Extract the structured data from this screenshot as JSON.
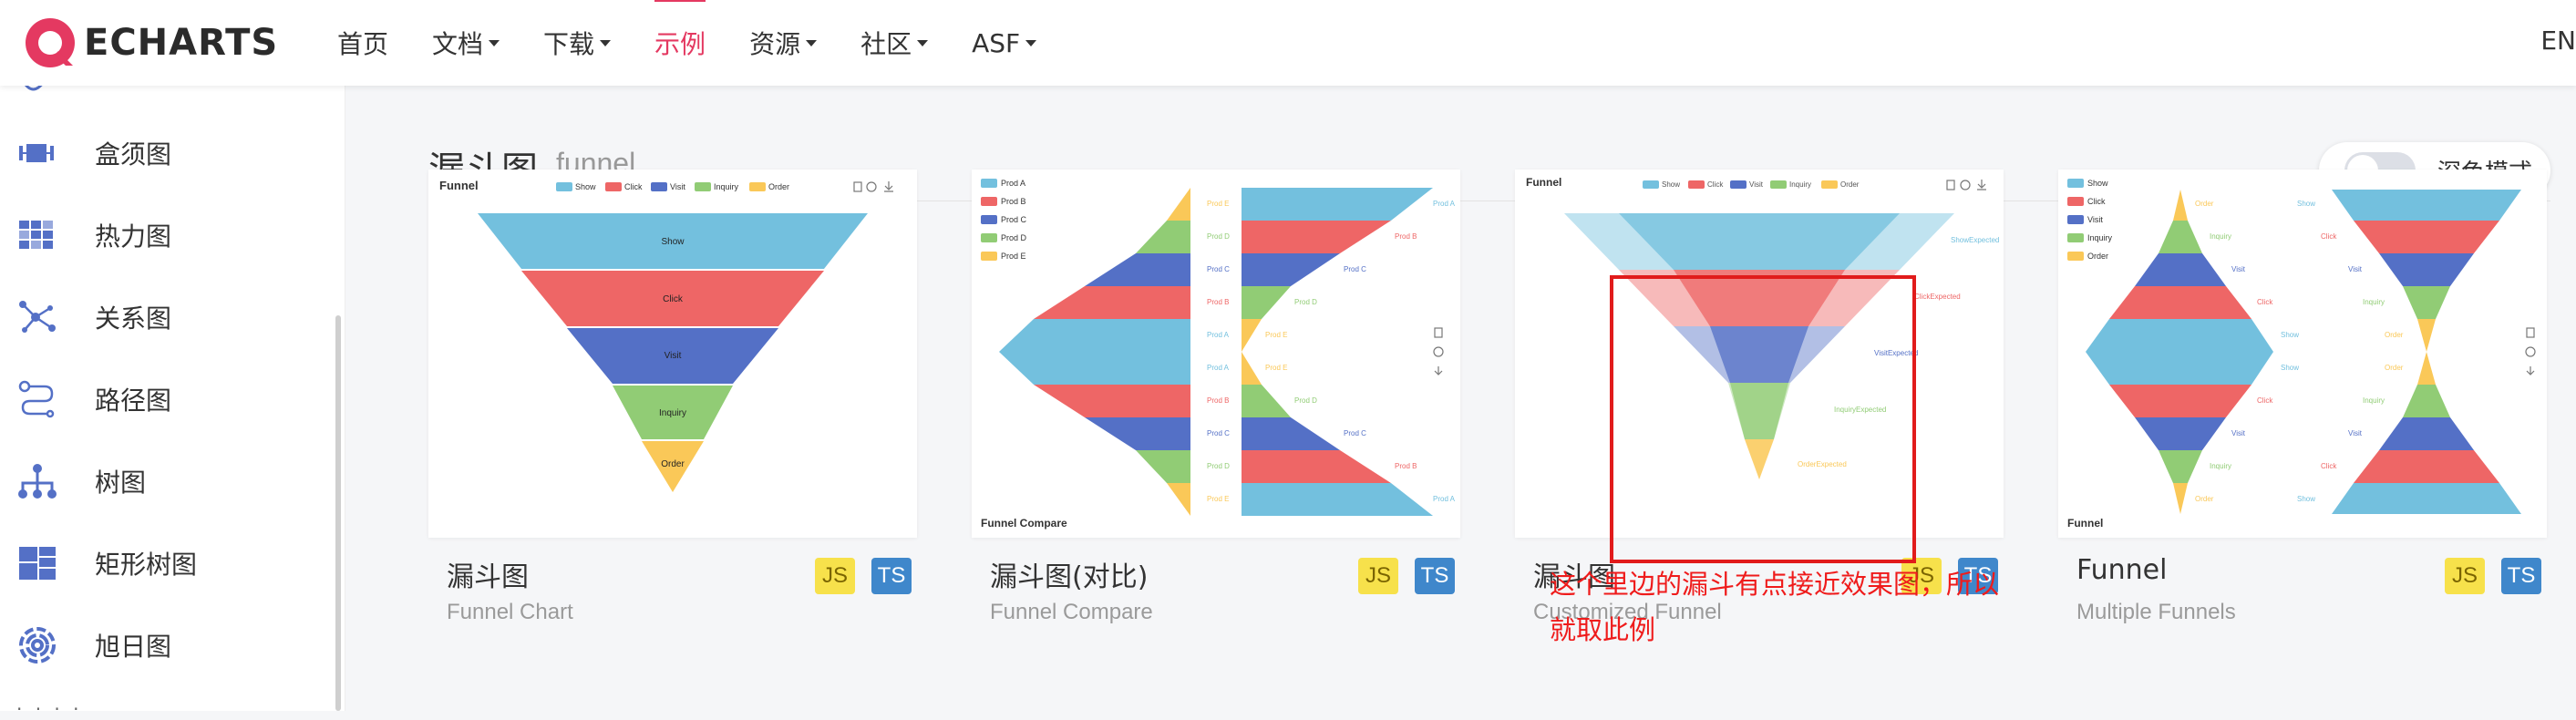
{
  "brand": {
    "logo_text": "ECHARTS",
    "accent": "#e43961"
  },
  "nav": {
    "items": [
      {
        "label": "首页",
        "dropdown": false,
        "active": false
      },
      {
        "label": "文档",
        "dropdown": true,
        "active": false
      },
      {
        "label": "下载",
        "dropdown": true,
        "active": false
      },
      {
        "label": "示例",
        "dropdown": false,
        "active": true
      },
      {
        "label": "资源",
        "dropdown": true,
        "active": false
      },
      {
        "label": "社区",
        "dropdown": true,
        "active": false
      },
      {
        "label": "ASF",
        "dropdown": true,
        "active": false
      }
    ],
    "lang": "EN"
  },
  "sidebar": {
    "items": [
      {
        "label": "盒须图",
        "icon": "boxplot-icon"
      },
      {
        "label": "热力图",
        "icon": "heatmap-icon"
      },
      {
        "label": "关系图",
        "icon": "graph-icon"
      },
      {
        "label": "路径图",
        "icon": "lines-icon"
      },
      {
        "label": "树图",
        "icon": "tree-icon"
      },
      {
        "label": "矩形树图",
        "icon": "treemap-icon"
      },
      {
        "label": "旭日图",
        "icon": "sunburst-icon"
      }
    ]
  },
  "page": {
    "title": "漏斗图",
    "subtitle": "funnel",
    "dark_mode_label": "深色模式"
  },
  "cards": [
    {
      "title": "漏斗图",
      "subtitle": "Funnel Chart",
      "badges": [
        "JS",
        "TS"
      ]
    },
    {
      "title": "漏斗图(对比)",
      "subtitle": "Funnel Compare",
      "badges": [
        "JS",
        "TS"
      ]
    },
    {
      "title": "漏斗图",
      "subtitle": "Customized Funnel",
      "badges": [
        "JS",
        "TS"
      ]
    },
    {
      "title": "Funnel",
      "subtitle": "Multiple Funnels",
      "badges": [
        "JS",
        "TS"
      ]
    }
  ],
  "thumbnails": {
    "funnel": {
      "title": "Funnel",
      "legend": [
        "Show",
        "Click",
        "Visit",
        "Inquiry",
        "Order"
      ]
    },
    "compare": {
      "title": "Funnel Compare",
      "legend": [
        "Prod A",
        "Prod B",
        "Prod C",
        "Prod D",
        "Prod E"
      ]
    },
    "customized": {
      "title": "Funnel",
      "legend": [
        "Show",
        "Click",
        "Visit",
        "Inquiry",
        "Order"
      ],
      "labels": [
        "ShowExpected",
        "ClickExpected",
        "VisitExpected",
        "InquiryExpected",
        "OrderExpected"
      ]
    },
    "multiple": {
      "title": "Funnel",
      "legend": [
        "Show",
        "Click",
        "Visit",
        "Inquiry",
        "Order"
      ]
    }
  },
  "annotation": "这个里边的漏斗有点接近效果图，所以就取此例",
  "colors": [
    "#73c0de",
    "#ee6666",
    "#5470c6",
    "#91cc75",
    "#fac858"
  ]
}
